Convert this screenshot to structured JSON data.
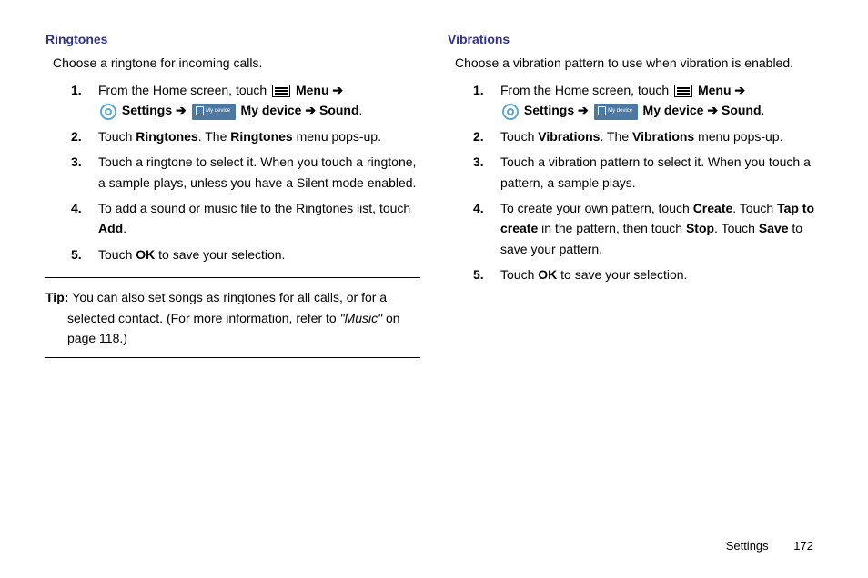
{
  "left": {
    "heading": "Ringtones",
    "intro": "Choose a ringtone for incoming calls.",
    "steps": {
      "s1a": "From the Home screen, touch ",
      "s1_menu": "Menu",
      "s1_arrow1": " ➔ ",
      "s1_settings": "Settings",
      "s1_arrow2": " ➔ ",
      "s1_mydevice": "My device",
      "s1_arrow3": " ➔ ",
      "s1_sound": "Sound",
      "s1_period": ".",
      "s2a": "Touch ",
      "s2b": "Ringtones",
      "s2c": ". The ",
      "s2d": "Ringtones",
      "s2e": " menu pops-up.",
      "s3": "Touch a ringtone to select it. When you touch a ringtone, a sample plays, unless you have a Silent mode enabled.",
      "s4a": "To add a sound or music file to the Ringtones list, touch ",
      "s4b": "Add",
      "s4c": ".",
      "s5a": "Touch ",
      "s5b": "OK",
      "s5c": " to save your selection."
    },
    "tip": {
      "label": "Tip: ",
      "a": "You can also set songs as ringtones for all calls, or for a selected contact. (For more information, refer to ",
      "ref": "\"Music\"",
      "b": " on page 118.)"
    }
  },
  "right": {
    "heading": "Vibrations",
    "intro": "Choose a vibration pattern to use when vibration is enabled.",
    "steps": {
      "s1a": "From the Home screen, touch ",
      "s1_menu": "Menu",
      "s1_arrow1": " ➔ ",
      "s1_settings": "Settings",
      "s1_arrow2": " ➔ ",
      "s1_mydevice": "My device",
      "s1_arrow3": " ➔ ",
      "s1_sound": "Sound",
      "s1_period": ".",
      "s2a": "Touch ",
      "s2b": "Vibrations",
      "s2c": ". The ",
      "s2d": "Vibrations",
      "s2e": " menu pops-up.",
      "s3": "Touch a vibration pattern to select it. When you touch a pattern, a sample plays.",
      "s4a": "To create your own pattern, touch ",
      "s4b": "Create",
      "s4c": ". Touch ",
      "s4d": "Tap to create",
      "s4e": " in the pattern, then touch ",
      "s4f": "Stop",
      "s4g": ". Touch ",
      "s4h": "Save",
      "s4i": " to save your pattern.",
      "s5a": "Touch ",
      "s5b": "OK",
      "s5c": " to save your selection."
    }
  },
  "footer": {
    "section": "Settings",
    "page": "172"
  },
  "nums": {
    "n1": "1.",
    "n2": "2.",
    "n3": "3.",
    "n4": "4.",
    "n5": "5."
  },
  "mydevice_text": "My device"
}
